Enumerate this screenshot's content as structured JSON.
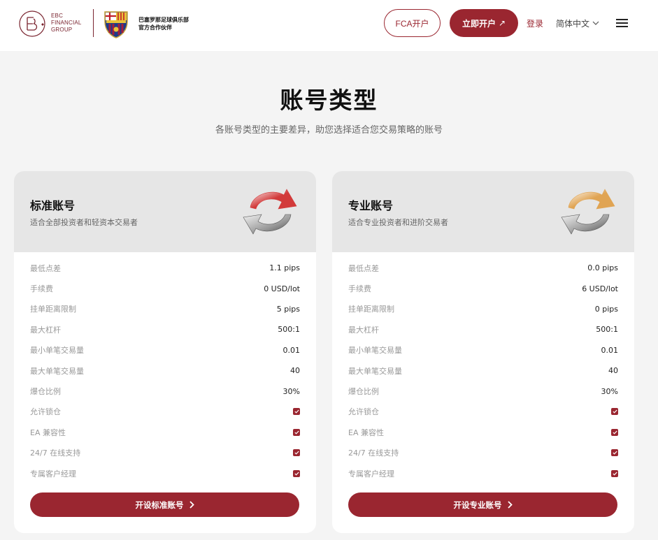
{
  "header": {
    "logo_lines": [
      "EBC",
      "FINANCIAL",
      "GROUP"
    ],
    "partner_lines": [
      "巴塞罗那足球俱乐部",
      "官方合作伙伴"
    ],
    "fca_label": "FCA开户",
    "open_label": "立即开户",
    "open_arrow": "↗",
    "login_label": "登录",
    "language": "简体中文",
    "brand_color": "#9a2630"
  },
  "page": {
    "title": "账号类型",
    "subtitle": "各账号类型的主要差异，助您选择适合您交易策略的账号"
  },
  "accounts": [
    {
      "title": "标准账号",
      "desc": "适合全部投资者和轻资本交易者",
      "art_color": "#d23a3a",
      "rows": [
        {
          "label": "最低点差",
          "value": "1.1 pips"
        },
        {
          "label": "手续费",
          "value": "0 USD/lot"
        },
        {
          "label": "挂单距离限制",
          "value": "5 pips"
        },
        {
          "label": "最大杠杆",
          "value": "500:1"
        },
        {
          "label": "最小单笔交易量",
          "value": "0.01"
        },
        {
          "label": "最大单笔交易量",
          "value": "40"
        },
        {
          "label": "爆仓比例",
          "value": "30%"
        },
        {
          "label": "允许锁仓",
          "checked": true
        },
        {
          "label": "EA 兼容性",
          "checked": true
        },
        {
          "label": "24/7 在线支持",
          "checked": true
        },
        {
          "label": "专属客户经理",
          "checked": true
        }
      ],
      "button": "开设标准账号"
    },
    {
      "title": "专业账号",
      "desc": "适合专业投资者和进阶交易者",
      "art_color": "#e0a453",
      "rows": [
        {
          "label": "最低点差",
          "value": "0.0 pips"
        },
        {
          "label": "手续费",
          "value": "6 USD/lot"
        },
        {
          "label": "挂单距离限制",
          "value": "0 pips"
        },
        {
          "label": "最大杠杆",
          "value": "500:1"
        },
        {
          "label": "最小单笔交易量",
          "value": "0.01"
        },
        {
          "label": "最大单笔交易量",
          "value": "40"
        },
        {
          "label": "爆仓比例",
          "value": "30%"
        },
        {
          "label": "允许锁仓",
          "checked": true
        },
        {
          "label": "EA 兼容性",
          "checked": true
        },
        {
          "label": "24/7 在线支持",
          "checked": true
        },
        {
          "label": "专属客户经理",
          "checked": true
        }
      ],
      "button": "开设专业账号"
    }
  ]
}
